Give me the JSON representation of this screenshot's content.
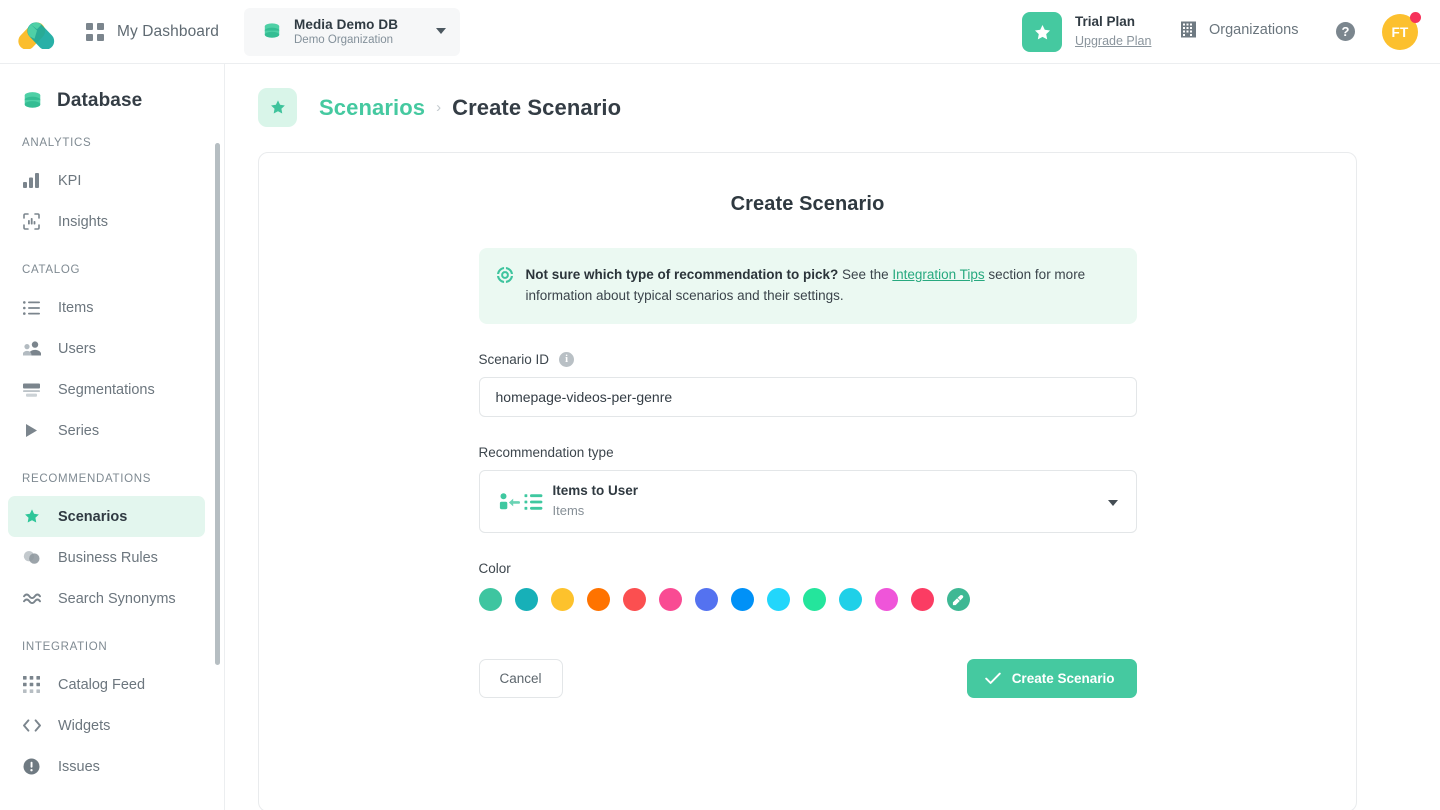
{
  "topbar": {
    "logo_name": "app-logo",
    "dashboard_label": "My Dashboard",
    "org": {
      "name": "Media Demo DB",
      "subtitle": "Demo Organization"
    },
    "plan": {
      "title": "Trial Plan",
      "upgrade_label": "Upgrade Plan"
    },
    "organizations_label": "Organizations",
    "help_glyph": "?",
    "avatar_initials": "FT"
  },
  "sidebar": {
    "database_label": "Database",
    "sections": [
      {
        "label": "ANALYTICS",
        "items": [
          {
            "label": "KPI",
            "icon": "bar-chart-icon",
            "active": false
          },
          {
            "label": "Insights",
            "icon": "insights-icon",
            "active": false
          }
        ]
      },
      {
        "label": "CATALOG",
        "items": [
          {
            "label": "Items",
            "icon": "list-icon",
            "active": false
          },
          {
            "label": "Users",
            "icon": "users-icon",
            "active": false
          },
          {
            "label": "Segmentations",
            "icon": "segmentations-icon",
            "active": false
          },
          {
            "label": "Series",
            "icon": "play-icon",
            "active": false
          }
        ]
      },
      {
        "label": "RECOMMENDATIONS",
        "items": [
          {
            "label": "Scenarios",
            "icon": "star-icon",
            "active": true
          },
          {
            "label": "Business Rules",
            "icon": "business-rules-icon",
            "active": false
          },
          {
            "label": "Search Synonyms",
            "icon": "synonyms-icon",
            "active": false
          }
        ]
      },
      {
        "label": "INTEGRATION",
        "items": [
          {
            "label": "Catalog Feed",
            "icon": "dots-grid-icon",
            "active": false
          },
          {
            "label": "Widgets",
            "icon": "code-icon",
            "active": false
          },
          {
            "label": "Issues",
            "icon": "alert-icon",
            "active": false
          }
        ]
      }
    ]
  },
  "breadcrumb": {
    "parent": "Scenarios",
    "separator": "›",
    "current": "Create Scenario"
  },
  "card": {
    "title": "Create Scenario",
    "tip": {
      "bold": "Not sure which type of recommendation to pick?",
      "before_link": " See the ",
      "link": "Integration Tips",
      "after_link": " section for more information about typical scenarios and their settings."
    },
    "scenario_id": {
      "label": "Scenario ID",
      "info_glyph": "i",
      "value": "homepage-videos-per-genre",
      "placeholder": "Scenario ID"
    },
    "recommendation_type": {
      "label": "Recommendation type",
      "selected_title": "Items to User",
      "selected_subtitle": "Items"
    },
    "color": {
      "label": "Color",
      "swatches": [
        "#3ec5a0",
        "#17b0b8",
        "#fdc22c",
        "#ff7300",
        "#fb4f50",
        "#f94b93",
        "#5472f0",
        "#0091f7",
        "#22d6fb",
        "#24e59c",
        "#1fd0e8",
        "#ef55d9",
        "#fb3c63"
      ],
      "custom_label": "custom-color-picker",
      "custom_bg": "#3eb894"
    },
    "actions": {
      "cancel_label": "Cancel",
      "create_label": "Create Scenario"
    }
  }
}
